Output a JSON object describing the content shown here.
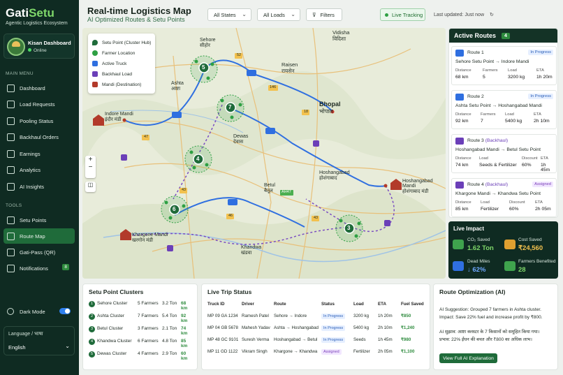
{
  "brand": {
    "name_main": "Gati",
    "name_accent": "Setu",
    "tagline": "Agentic Logistics Ecosystem"
  },
  "profile": {
    "name": "Kisan Dashboard",
    "status": "Online"
  },
  "menu": {
    "heading": "MAIN MENU",
    "items": [
      {
        "label": "Dashboard"
      },
      {
        "label": "Load Requests"
      },
      {
        "label": "Pooling Status"
      },
      {
        "label": "Backhaul Orders"
      },
      {
        "label": "Earnings"
      },
      {
        "label": "Analytics"
      },
      {
        "label": "AI Insights"
      }
    ]
  },
  "tools": {
    "heading": "TOOLS",
    "items": [
      {
        "label": "Setu Points"
      },
      {
        "label": "Route Map"
      },
      {
        "label": "Gati-Pass (QR)"
      },
      {
        "label": "Notifications",
        "badge": "8"
      }
    ]
  },
  "settings": {
    "dark_mode": "Dark Mode",
    "language_label": "Language / भाषा",
    "language_value": "English"
  },
  "header": {
    "title": "Real-time Logistics Map",
    "subtitle": "AI Optimized Routes & Setu Points",
    "states": "All States",
    "loads": "All Loads",
    "filters": "Filters",
    "live": "Live Tracking",
    "updated": "Last updated: Just now"
  },
  "legend": [
    {
      "label": "Setu Point (Cluster Hub)",
      "color": "#1f6b3a"
    },
    {
      "label": "Farmer Location",
      "color": "#2ea043"
    },
    {
      "label": "Active Truck",
      "color": "#2f6fe0"
    },
    {
      "label": "Backhaul Load",
      "color": "#6b3fb8"
    },
    {
      "label": "Mandi (Destination)",
      "color": "#b23a2a"
    }
  ],
  "map_labels": {
    "vidisha": "Vidisha",
    "vidisha_hi": "विदिशा",
    "sehore": "Sehore",
    "sehore_hi": "सीहोर",
    "raisen": "Raisen",
    "raisen_hi": "रायसेन",
    "ashta": "Ashta",
    "ashta_hi": "आष्टा",
    "bhopal": "Bhopal",
    "bhopal_hi": "भोपाल",
    "indore": "Indore Mandi",
    "indore_hi": "इंदौर मंडी",
    "dewas": "Dewas",
    "dewas_hi": "देवास",
    "hoshangabad": "Hoshangabad",
    "hoshangabad_hi": "होशंगाबाद",
    "hosh_mandi": "Hoshangabad Mandi",
    "hosh_mandi_hi": "होशंगाबाद मंडी",
    "betul": "Betul",
    "betul_hi": "बैतूल",
    "khargone": "Khargone Mandi",
    "khargone_hi": "खरगोन मंडी",
    "khandwa": "Khandwa",
    "khandwa_hi": "खंडवा",
    "r52": "52",
    "r146": "146",
    "r18": "18",
    "r46": "46",
    "r47": "47",
    "r43a": "43",
    "r43b": "43",
    "r43c": "43",
    "ah47": "AH47",
    "c5": "5",
    "c7": "7",
    "c4": "4",
    "c6": "6",
    "c3": "3"
  },
  "active_routes": {
    "title": "Active Routes",
    "count": "4",
    "routes": [
      {
        "name": "Route 1",
        "status": "In Progress",
        "from": "Sehore Setu Point",
        "to": "Indore Mandi",
        "k1": "Distance",
        "v1": "68 km",
        "k2": "Farmers",
        "v2": "5",
        "k3": "Load",
        "v3": "3200 kg",
        "k4": "ETA",
        "v4": "1h 20m"
      },
      {
        "name": "Route 2",
        "status": "In Progress",
        "from": "Ashta Setu Point",
        "to": "Hoshangabad Mandi",
        "k1": "Distance",
        "v1": "92 km",
        "k2": "Farmers",
        "v2": "7",
        "k3": "Load",
        "v3": "5400 kg",
        "k4": "ETA",
        "v4": "2h 10m"
      },
      {
        "name": "Route 3",
        "type": "(Backhaul)",
        "status": "In Progress",
        "from": "Hoshangabad Mandi",
        "to": "Betul Setu Point",
        "k1": "Distance",
        "v1": "74 km",
        "k2": "Load",
        "v2": "Seeds & Fertilizer",
        "k3": "Discount",
        "v3": "60%",
        "k4": "ETA",
        "v4": "1h 45m"
      },
      {
        "name": "Route 4",
        "type": "(Backhaul)",
        "status": "Assigned",
        "from": "Khargone Mandi",
        "to": "Khandwa Setu Point",
        "k1": "Distance",
        "v1": "85 km",
        "k2": "Load",
        "v2": "Fertilizer",
        "k3": "Discount",
        "v3": "60%",
        "k4": "ETA",
        "v4": "2h 05m"
      }
    ]
  },
  "impact": {
    "title": "Live Impact",
    "co2_label": "CO₂ Saved",
    "co2": "1.62 Ton",
    "cost_label": "Cost Saved",
    "cost": "₹24,560",
    "dead_label": "Dead Miles",
    "dead": "↓ 62%",
    "farmers_label": "Farmers Benefited",
    "farmers": "28"
  },
  "clusters": {
    "title": "Setu Point Clusters",
    "rows": [
      {
        "n": "1",
        "name": "Sehore Cluster",
        "farmers": "5 Farmers",
        "ton": "3.2 Ton",
        "km": "68 km"
      },
      {
        "n": "2",
        "name": "Ashta Cluster",
        "farmers": "7 Farmers",
        "ton": "5.4 Ton",
        "km": "92 km"
      },
      {
        "n": "3",
        "name": "Betul Cluster",
        "farmers": "3 Farmers",
        "ton": "2.1 Ton",
        "km": "74 km"
      },
      {
        "n": "4",
        "name": "Khandwa Cluster",
        "farmers": "6 Farmers",
        "ton": "4.8 Ton",
        "km": "85 km"
      },
      {
        "n": "5",
        "name": "Dewas Cluster",
        "farmers": "4 Farmers",
        "ton": "2.9 Ton",
        "km": "60 km"
      }
    ]
  },
  "trips": {
    "title": "Live Trip Status",
    "headers": [
      "Truck ID",
      "Driver",
      "Route",
      "Status",
      "Load",
      "ETA",
      "Fuel Saved"
    ],
    "rows": [
      [
        "MP 09 GA 1234",
        "Ramesh Patel",
        "Sehore → Indore",
        "In Progress",
        "3200 kg",
        "1h 20m",
        "₹850"
      ],
      [
        "MP 04 GB 5678",
        "Mahesh Yadav",
        "Ashta → Hoshangabad",
        "In Progress",
        "5400 kg",
        "2h 10m",
        "₹1,240"
      ],
      [
        "MP 48 GC 9101",
        "Suresh Verma",
        "Hoshangabad → Betul",
        "In Progress",
        "Seeds",
        "1h 45m",
        "₹980"
      ],
      [
        "MP 11 GD 1122",
        "Vikram Singh",
        "Khargone → Khandwa",
        "Assigned",
        "Fertilizer",
        "2h 05m",
        "₹1,100"
      ]
    ]
  },
  "ai": {
    "title": "Route Optimization (AI)",
    "s1": "AI Suggestion: Grouped 7 farmers in Ashta cluster.",
    "s2": "Impact: Save 22% fuel and increase profit by ₹800.",
    "h1": "AI सुझाव: आष्टा क्लस्टर के 7 किसानों को समूहित किया गया।",
    "h2": "प्रभाव: 22% ईंधन की बचत और ₹800 का अधिक लाभ।",
    "button": "View Full AI Explanation"
  }
}
